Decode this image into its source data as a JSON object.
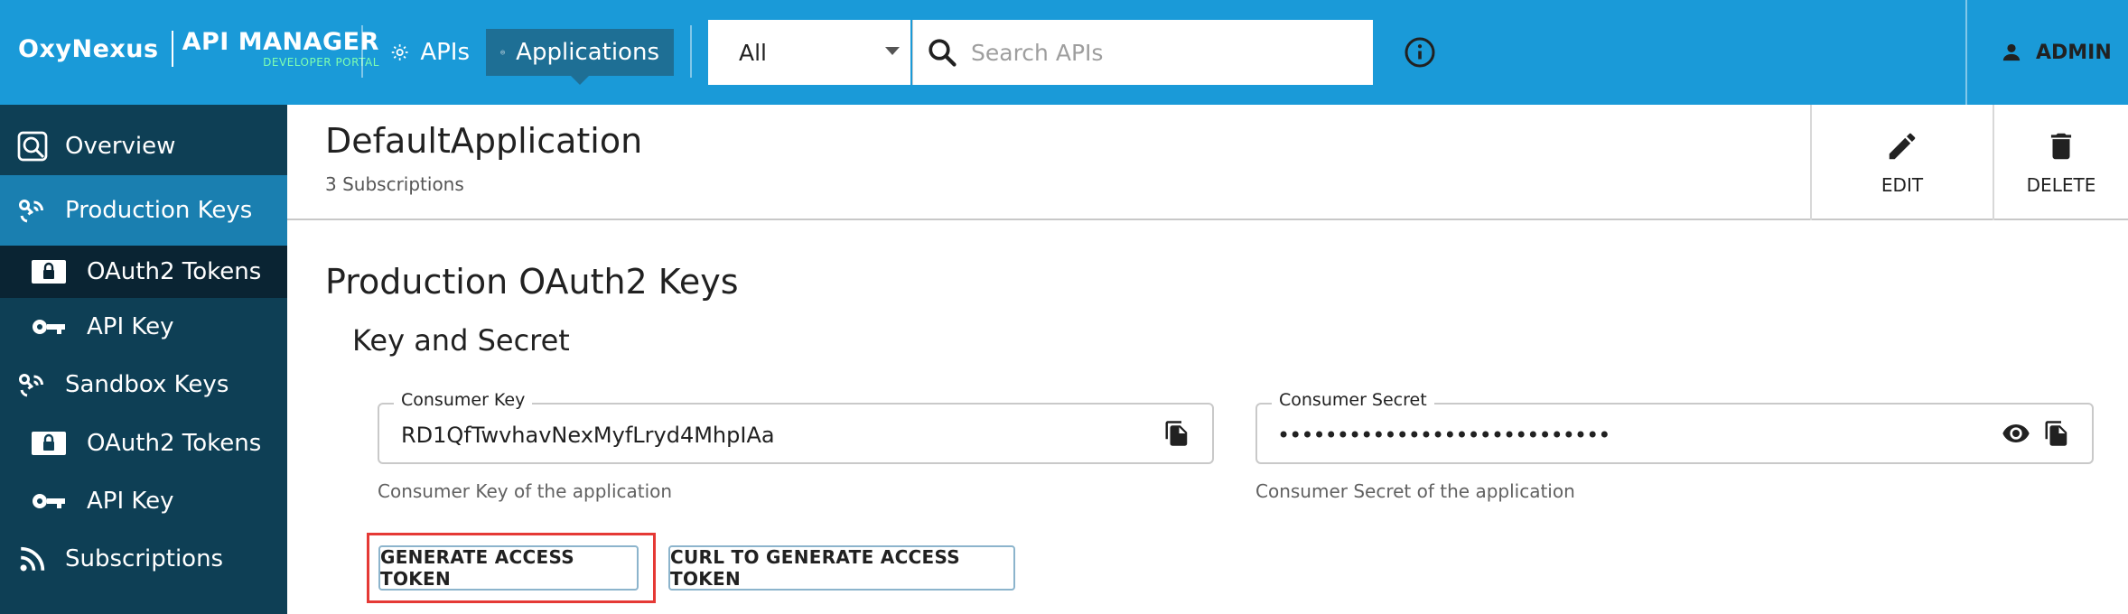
{
  "brand": {
    "name": "OxyNexus",
    "title": "API MANAGER",
    "subtitle": "DEVELOPER PORTAL"
  },
  "nav": {
    "apis_label": "APIs",
    "applications_label": "Applications",
    "active": "Applications"
  },
  "search": {
    "filter_value": "All",
    "placeholder": "Search APIs"
  },
  "user": {
    "name": "ADMIN"
  },
  "sidebar": {
    "items": [
      {
        "label": "Overview",
        "icon": "overview-icon"
      },
      {
        "label": "Production Keys",
        "icon": "keys-icon",
        "active": true
      },
      {
        "label": "OAuth2 Tokens",
        "icon": "lock-icon",
        "selected": true
      },
      {
        "label": "API Key",
        "icon": "key-icon"
      },
      {
        "label": "Sandbox Keys",
        "icon": "keys-icon"
      },
      {
        "label": "OAuth2 Tokens",
        "icon": "lock-icon"
      },
      {
        "label": "API Key",
        "icon": "key-icon"
      },
      {
        "label": "Subscriptions",
        "icon": "rss-icon"
      }
    ]
  },
  "app": {
    "name": "DefaultApplication",
    "subscriptions": "3 Subscriptions",
    "edit_label": "EDIT",
    "delete_label": "DELETE"
  },
  "keys": {
    "section_title": "Production OAuth2 Keys",
    "subsection_title": "Key and Secret",
    "consumer_key_label": "Consumer Key",
    "consumer_key_value": "RD1QfTwvhavNexMyfLryd4MhpIAa",
    "consumer_key_helper": "Consumer Key of the application",
    "consumer_secret_label": "Consumer Secret",
    "consumer_secret_value": "••••••••••••••••••••••••••••",
    "consumer_secret_helper": "Consumer Secret of the application",
    "generate_label": "GENERATE ACCESS TOKEN",
    "curl_label": "CURL TO GENERATE ACCESS TOKEN"
  },
  "colors": {
    "topbar": "#1a9ad8",
    "sidebar": "#0e3f55",
    "sidebar_active": "#1a7fb0",
    "highlight": "#e53935"
  }
}
